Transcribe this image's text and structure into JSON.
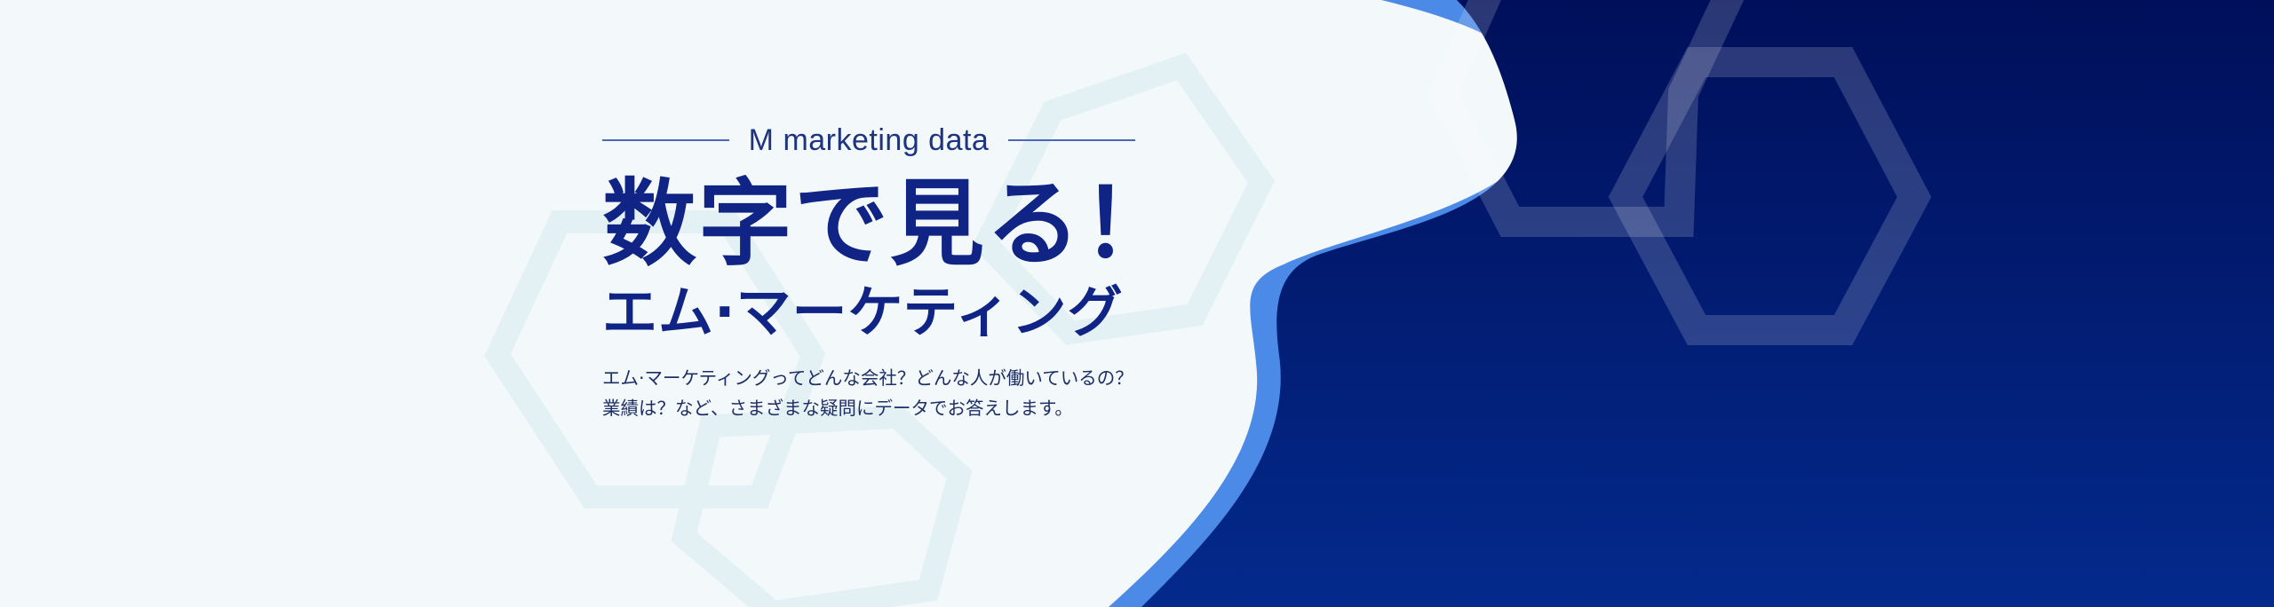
{
  "banner": {
    "eyebrow": "M marketing data",
    "title_main": "数字で見る！",
    "title_sub": "エム·マーケティング",
    "description_line1": "エム·マーケティングってどんな会社？どんな人が働いているの？",
    "description_line2": "業績は？など、さまざまな疑問にデータでお答えします。"
  },
  "colors": {
    "background_light": "#f3f8fb",
    "navy_dark": "#000f5a",
    "navy": "#03298a",
    "accent_blue": "#4b8ae6",
    "title_navy": "#0f2484",
    "hexagon_light": "#e3f1f5"
  }
}
